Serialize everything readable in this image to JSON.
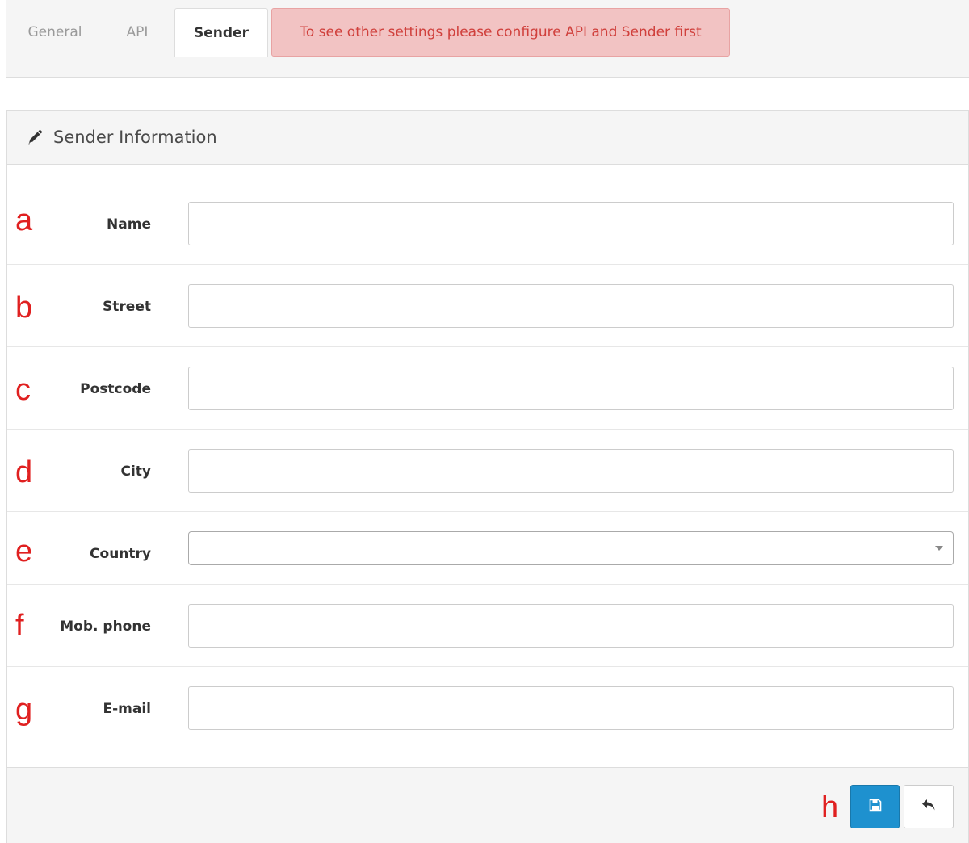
{
  "tabs": [
    {
      "label": "General",
      "active": false
    },
    {
      "label": "API",
      "active": false
    },
    {
      "label": "Sender",
      "active": true
    }
  ],
  "alert": {
    "text": "To see other settings please configure API and Sender first",
    "color": "#d0403c",
    "background": "#f2c3c3"
  },
  "panel": {
    "title": "Sender Information",
    "icon": "pencil-icon"
  },
  "form": {
    "fields": [
      {
        "letter": "a",
        "label": "Name",
        "type": "text",
        "value": ""
      },
      {
        "letter": "b",
        "label": "Street",
        "type": "text",
        "value": ""
      },
      {
        "letter": "c",
        "label": "Postcode",
        "type": "text",
        "value": ""
      },
      {
        "letter": "d",
        "label": "City",
        "type": "text",
        "value": ""
      },
      {
        "letter": "e",
        "label": "Country",
        "type": "select",
        "value": ""
      },
      {
        "letter": "f",
        "label": "Mob. phone",
        "type": "text",
        "value": ""
      },
      {
        "letter": "g",
        "label": "E-mail",
        "type": "text",
        "value": ""
      }
    ]
  },
  "footer": {
    "letter": "h",
    "save_icon": "floppy-disk-icon",
    "back_icon": "reply-arrow-icon",
    "primary_color": "#1e91cf"
  }
}
